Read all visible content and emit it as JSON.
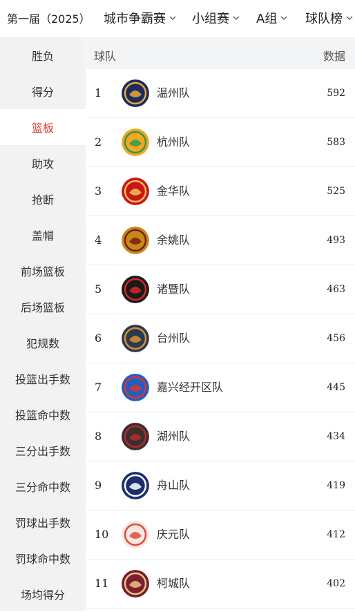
{
  "topbar": {
    "season": "第一届（2025）",
    "menus": [
      {
        "label": "城市争霸赛",
        "icon": "chevron-down-icon"
      },
      {
        "label": "小组赛",
        "icon": "chevron-down-icon"
      },
      {
        "label": "A组",
        "icon": "chevron-down-icon"
      },
      {
        "label": "球队榜",
        "icon": "chevron-down-icon"
      }
    ]
  },
  "sidebar": {
    "active_index": 2,
    "items": [
      {
        "label": "胜负"
      },
      {
        "label": "得分"
      },
      {
        "label": "篮板"
      },
      {
        "label": "助攻"
      },
      {
        "label": "抢断"
      },
      {
        "label": "盖帽"
      },
      {
        "label": "前场篮板"
      },
      {
        "label": "后场篮板"
      },
      {
        "label": "犯规数"
      },
      {
        "label": "投篮出手数"
      },
      {
        "label": "投篮命中数"
      },
      {
        "label": "三分出手数"
      },
      {
        "label": "三分命中数"
      },
      {
        "label": "罚球出手数"
      },
      {
        "label": "罚球命中数"
      },
      {
        "label": "场均得分"
      }
    ]
  },
  "table": {
    "header": {
      "team": "球队",
      "data": "数据"
    },
    "rows": [
      {
        "rank": "1",
        "team": "温州队",
        "value": "592",
        "logo_colors": [
          "#1d2a5c",
          "#e8a93a"
        ]
      },
      {
        "rank": "2",
        "team": "杭州队",
        "value": "583",
        "logo_colors": [
          "#f5a623",
          "#2d9c4a"
        ]
      },
      {
        "rank": "3",
        "team": "金华队",
        "value": "525",
        "logo_colors": [
          "#c8161d",
          "#f2c14e"
        ]
      },
      {
        "rank": "4",
        "team": "余姚队",
        "value": "493",
        "logo_colors": [
          "#c48a1c",
          "#7a1a12"
        ]
      },
      {
        "rank": "5",
        "team": "诸暨队",
        "value": "463",
        "logo_colors": [
          "#1a1a1a",
          "#d8262c"
        ]
      },
      {
        "rank": "6",
        "team": "台州队",
        "value": "456",
        "logo_colors": [
          "#2a3a55",
          "#d9902b"
        ]
      },
      {
        "rank": "7",
        "team": "嘉兴经开区队",
        "value": "445",
        "logo_colors": [
          "#1f5fc4",
          "#e0322b"
        ]
      },
      {
        "rank": "8",
        "team": "湖州队",
        "value": "434",
        "logo_colors": [
          "#3a2e2e",
          "#b32a2a"
        ]
      },
      {
        "rank": "9",
        "team": "舟山队",
        "value": "419",
        "logo_colors": [
          "#1a2f6b",
          "#ffffff"
        ]
      },
      {
        "rank": "10",
        "team": "庆元队",
        "value": "412",
        "logo_colors": [
          "#f3e8e2",
          "#e04a3a"
        ]
      },
      {
        "rank": "11",
        "team": "柯城队",
        "value": "402",
        "logo_colors": [
          "#7a1f2b",
          "#e6c48a"
        ]
      }
    ]
  },
  "colors": {
    "active": "#e03c31",
    "sidebar_bg": "#f2f2f2",
    "header_bg": "#f3f4f6"
  }
}
